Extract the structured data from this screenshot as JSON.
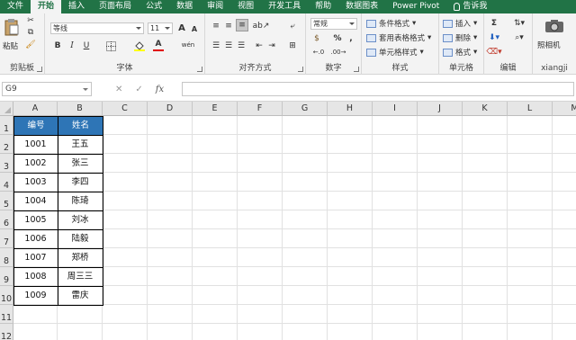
{
  "ribbon_tabs": [
    "文件",
    "开始",
    "插入",
    "页面布局",
    "公式",
    "数据",
    "审阅",
    "视图",
    "开发工具",
    "帮助",
    "数据图表",
    "Power Pivot",
    "告诉我"
  ],
  "active_tab": "开始",
  "clipboard": {
    "paste": "粘贴",
    "label": "剪贴板"
  },
  "font": {
    "name": "等线",
    "size": "11",
    "label": "字体",
    "bold": "B",
    "italic": "I",
    "underline": "U",
    "grow": "A",
    "shrink": "A",
    "font_color": "A",
    "phonetic": "wén"
  },
  "alignment": {
    "label": "对齐方式"
  },
  "number": {
    "format": "常规",
    "percent": "%",
    "comma": ",",
    "label": "数字"
  },
  "styles": {
    "conditional": "条件格式",
    "table": "套用表格格式",
    "cell": "单元格样式",
    "label": "样式"
  },
  "cells": {
    "insert": "插入",
    "delete": "删除",
    "format": "格式",
    "label": "单元格"
  },
  "editing": {
    "sum": "Σ",
    "label": "编辑"
  },
  "camera": {
    "button": "照相机",
    "label": "xiangji"
  },
  "formula_bar": {
    "name_box": "G9",
    "cancel": "✕",
    "enter": "✓",
    "fx": "fx",
    "formula": ""
  },
  "columns": [
    "A",
    "B",
    "C",
    "D",
    "E",
    "F",
    "G",
    "H",
    "I",
    "J",
    "K",
    "L",
    "M"
  ],
  "rows": [
    "1",
    "2",
    "3",
    "4",
    "5",
    "6",
    "7",
    "8",
    "9",
    "10",
    "11",
    "12"
  ],
  "table": {
    "headers": [
      "编号",
      "姓名"
    ],
    "rows": [
      [
        "1001",
        "王五"
      ],
      [
        "1002",
        "张三"
      ],
      [
        "1003",
        "李四"
      ],
      [
        "1004",
        "陈琦"
      ],
      [
        "1005",
        "刘冰"
      ],
      [
        "1006",
        "陆毅"
      ],
      [
        "1007",
        "郑桥"
      ],
      [
        "1008",
        "周三三"
      ],
      [
        "1009",
        "雷庆"
      ]
    ]
  },
  "colors": {
    "ribbon_green": "#217346",
    "header_fill": "#2e75b6",
    "header_text": "#ffffff"
  }
}
